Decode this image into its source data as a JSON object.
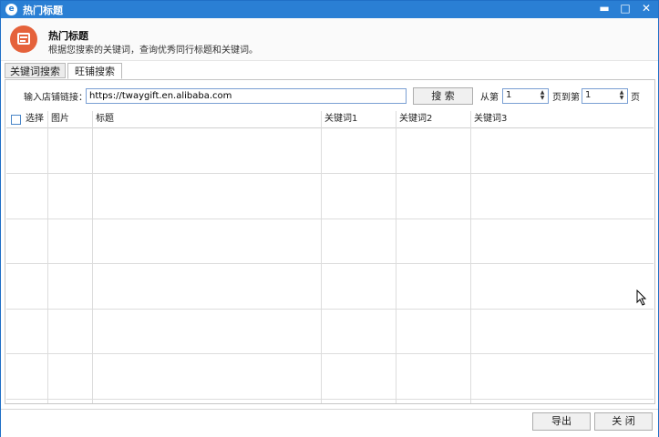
{
  "window": {
    "title": "热门标题",
    "minimize": "▬",
    "maximize": "□",
    "close": "✕"
  },
  "header": {
    "title": "热门标题",
    "description": "根据您搜索的关键词，查询优秀同行标题和关键词。"
  },
  "tabs": [
    {
      "label": "关键词搜索",
      "active": false
    },
    {
      "label": "旺铺搜索",
      "active": true
    }
  ],
  "search": {
    "label": "输入店铺链接：",
    "value": "https://twaygift.en.alibaba.com",
    "button": "搜 索",
    "from_label": "从第",
    "from_value": "1",
    "to_label": "页到第",
    "to_value": "1",
    "end_label": "页"
  },
  "table": {
    "columns": [
      "选择",
      "图片",
      "标题",
      "关键词1",
      "关键词2",
      "关键词3"
    ],
    "rows": []
  },
  "footer": {
    "export": "导出",
    "close": "关 闭"
  },
  "colors": {
    "titlebar": "#2a7fd4",
    "accent_icon": "#e5623b"
  }
}
